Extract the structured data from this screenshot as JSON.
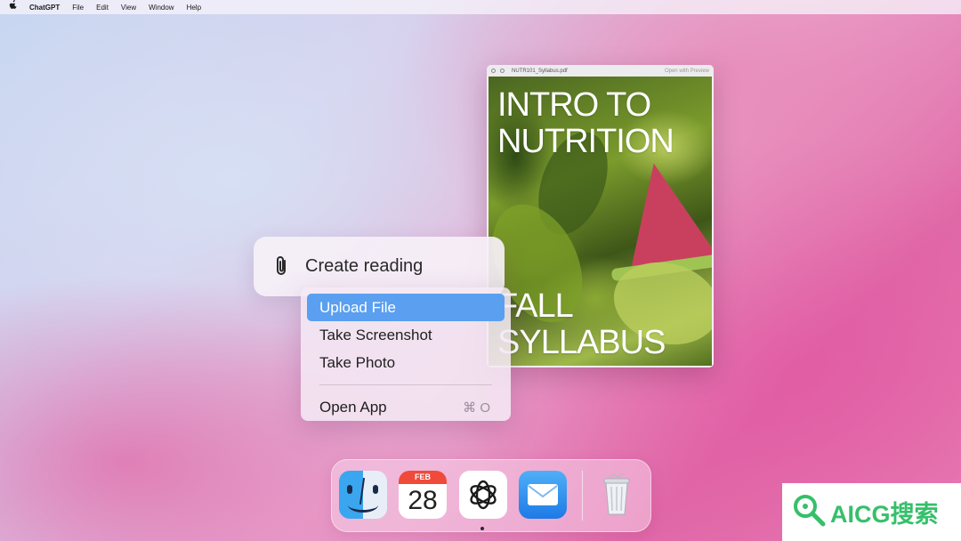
{
  "menubar": {
    "apple_icon": "apple-logo-icon",
    "app_name": "ChatGPT",
    "items": [
      "File",
      "Edit",
      "View",
      "Window",
      "Help"
    ]
  },
  "bubble": {
    "icon": "paperclip-icon",
    "label": "Create reading"
  },
  "menu": {
    "items": [
      {
        "label": "Upload File",
        "selected": true
      },
      {
        "label": "Take Screenshot",
        "selected": false
      },
      {
        "label": "Take Photo",
        "selected": false
      }
    ],
    "open_app": {
      "label": "Open App",
      "shortcut": "⌘ O"
    }
  },
  "pdf_window": {
    "filename": "NUTR101_Syllabus.pdf",
    "open_with": "Open with Preview",
    "cover_title_lines": [
      "INTRO TO",
      "NUTRITION"
    ],
    "cover_subtitle_lines": [
      "FALL",
      "SYLLABUS"
    ]
  },
  "dock": {
    "apps": [
      "finder-icon",
      "calendar-icon",
      "chatgpt-icon",
      "mail-icon",
      "trash-icon"
    ],
    "calendar": {
      "month": "FEB",
      "day": "28"
    },
    "active_app": "chatgpt"
  },
  "watermark": {
    "text": "AICG搜索"
  },
  "colors": {
    "selection_blue": "#5a9ff0",
    "watermark_green": "#35c06a",
    "calendar_red": "#f04a3a"
  }
}
